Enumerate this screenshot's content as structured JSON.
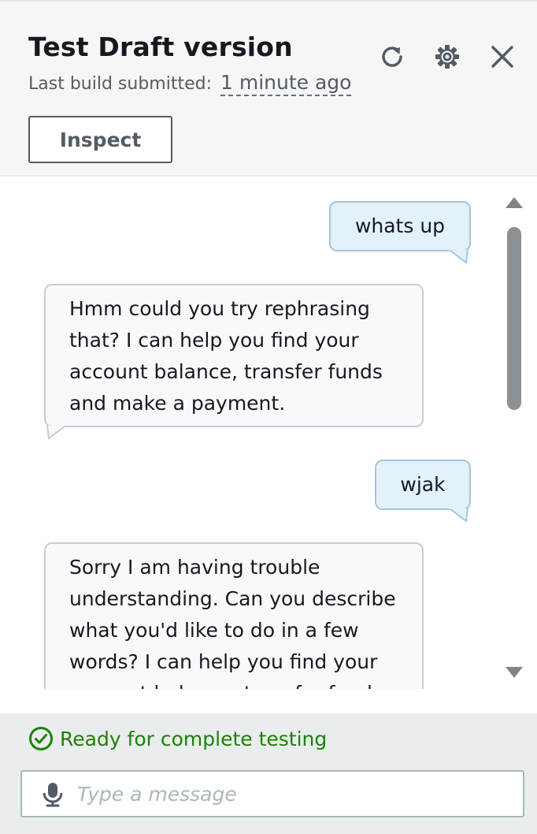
{
  "header": {
    "title": "Test Draft version",
    "build_label": "Last build submitted:",
    "build_time": "1 minute ago",
    "inspect_label": "Inspect",
    "icons": [
      "refresh-icon",
      "settings-icon",
      "close-icon"
    ]
  },
  "conversation": {
    "messages": [
      {
        "sender": "user",
        "text": "whats up"
      },
      {
        "sender": "bot",
        "lines": [
          "Hmm could you try rephrasing",
          "that? I can help you find your",
          "account balance, transfer funds",
          "and make a payment."
        ]
      },
      {
        "sender": "user",
        "text": "wjak"
      },
      {
        "sender": "bot",
        "lines": [
          "Sorry I am having trouble",
          "understanding. Can you describe",
          "what you'd like to do in a few",
          "words? I can help you find your",
          "account balance, transfer funds"
        ]
      }
    ]
  },
  "footer": {
    "status": "Ready for complete testing",
    "input_placeholder": "Type a message",
    "input_value": ""
  },
  "colors": {
    "status_green": "#1d8102",
    "user_bubble_bg": "#e3f1fb",
    "bot_bubble_bg": "#f7f9fb",
    "header_bg": "#f6f6f6",
    "footer_bg": "#eaedee"
  }
}
